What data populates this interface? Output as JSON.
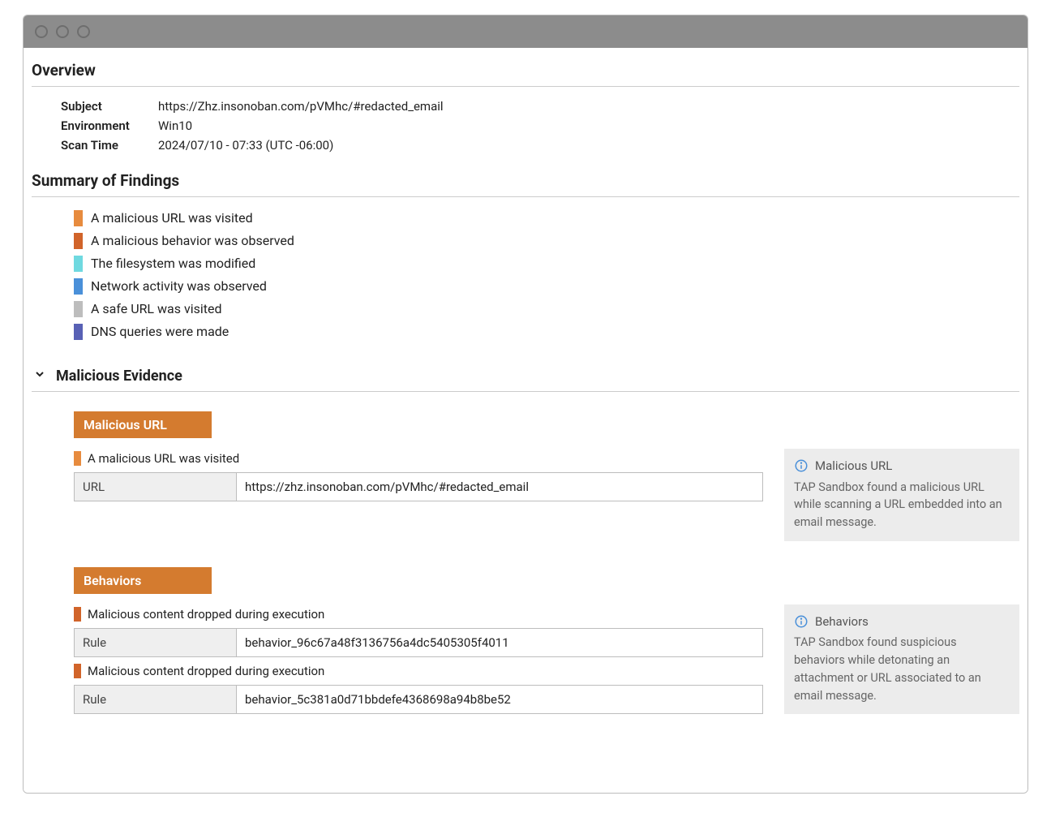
{
  "colors": {
    "orange": "#e78b3e",
    "orange_dark": "#d1642a",
    "cyan": "#6fd9e0",
    "blue": "#4a90d9",
    "gray": "#bdbdbd",
    "indigo": "#5861b5"
  },
  "overview": {
    "title": "Overview",
    "subject_label": "Subject",
    "subject_value": "https://Zhz.insonoban.com/pVMhc/#redacted_email",
    "environment_label": "Environment",
    "environment_value": "Win10",
    "scantime_label": "Scan Time",
    "scantime_value": "2024/07/10 - 07:33 (UTC -06:00)"
  },
  "summary": {
    "title": "Summary of Findings",
    "items": [
      {
        "color": "orange",
        "text": "A malicious URL was visited"
      },
      {
        "color": "orange_dark",
        "text": "A malicious behavior was observed"
      },
      {
        "color": "cyan",
        "text": "The filesystem was modified"
      },
      {
        "color": "blue",
        "text": "Network activity was observed"
      },
      {
        "color": "gray",
        "text": "A safe URL was visited"
      },
      {
        "color": "indigo",
        "text": "DNS queries were made"
      }
    ]
  },
  "evidence": {
    "title": "Malicious Evidence",
    "malicious_url": {
      "badge": "Malicious URL",
      "event_text": "A malicious URL was visited",
      "row_key": "URL",
      "row_val": "https://zhz.insonoban.com/pVMhc/#redacted_email",
      "info_title": "Malicious URL",
      "info_body": "TAP Sandbox found a malicious URL while scanning a URL embedded into an email message."
    },
    "behaviors": {
      "badge": "Behaviors",
      "event_text_1": "Malicious content dropped during execution",
      "row1_key": "Rule",
      "row1_val": "behavior_96c67a48f3136756a4dc5405305f4011",
      "event_text_2": "Malicious content dropped during execution",
      "row2_key": "Rule",
      "row2_val": "behavior_5c381a0d71bbdefe4368698a94b8be52",
      "info_title": "Behaviors",
      "info_body": "TAP Sandbox found suspicious behaviors while detonating an attachment or URL associated to an email message."
    }
  }
}
